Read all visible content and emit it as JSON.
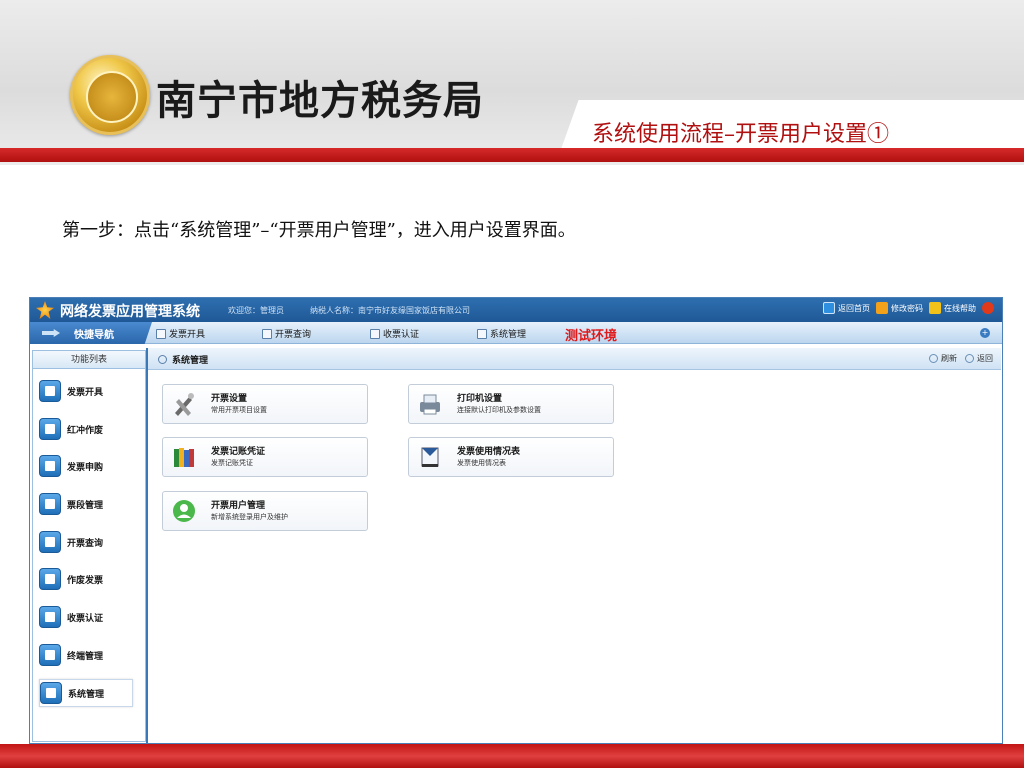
{
  "slide": {
    "org_title": "南宁市地方税务局",
    "subtitle": "系统使用流程–开票用户设置①",
    "step_text": "第一步：点击“系统管理”–“开票用户管理”，进入用户设置界面。"
  },
  "app": {
    "title": "网络发票应用管理系统",
    "welcome": "欢迎您：管理员",
    "taxpayer": "纳税人名称：南宁市好友缘国家饭店有限公司",
    "top_actions": [
      {
        "label": "返回首页",
        "icon": "home-icon",
        "color": "#2e8fe0"
      },
      {
        "label": "修改密码",
        "icon": "lock-icon",
        "color": "#f2a11a"
      },
      {
        "label": "在线帮助",
        "icon": "help-icon",
        "color": "#f2c21a"
      },
      {
        "label": "",
        "icon": "power-icon",
        "color": "#e03a1a"
      }
    ],
    "quicknav_label": "快捷导航",
    "nav_menu": [
      "发票开具",
      "开票查询",
      "收票认证",
      "系统管理"
    ],
    "test_env": "测试环境",
    "sidebar_head": "功能列表",
    "sidebar_items": [
      "发票开具",
      "红冲作废",
      "发票申购",
      "票段管理",
      "开票查询",
      "作废发票",
      "收票认证",
      "终端管理",
      "系统管理"
    ],
    "active_sidebar": "系统管理",
    "breadcrumb": "系统管理",
    "main_actions": [
      "刷新",
      "返回"
    ],
    "cards": [
      {
        "title": "开票设置",
        "desc": "常用开票项目设置",
        "icon": "tools-icon"
      },
      {
        "title": "打印机设置",
        "desc": "连接默认打印机及参数设置",
        "icon": "printer-icon"
      },
      {
        "title": "发票记账凭证",
        "desc": "发票记账凭证",
        "icon": "books-icon"
      },
      {
        "title": "发票使用情况表",
        "desc": "发票使用情况表",
        "icon": "report-icon"
      },
      {
        "title": "开票用户管理",
        "desc": "新增系统登录用户及维护",
        "icon": "user-icon"
      }
    ]
  }
}
